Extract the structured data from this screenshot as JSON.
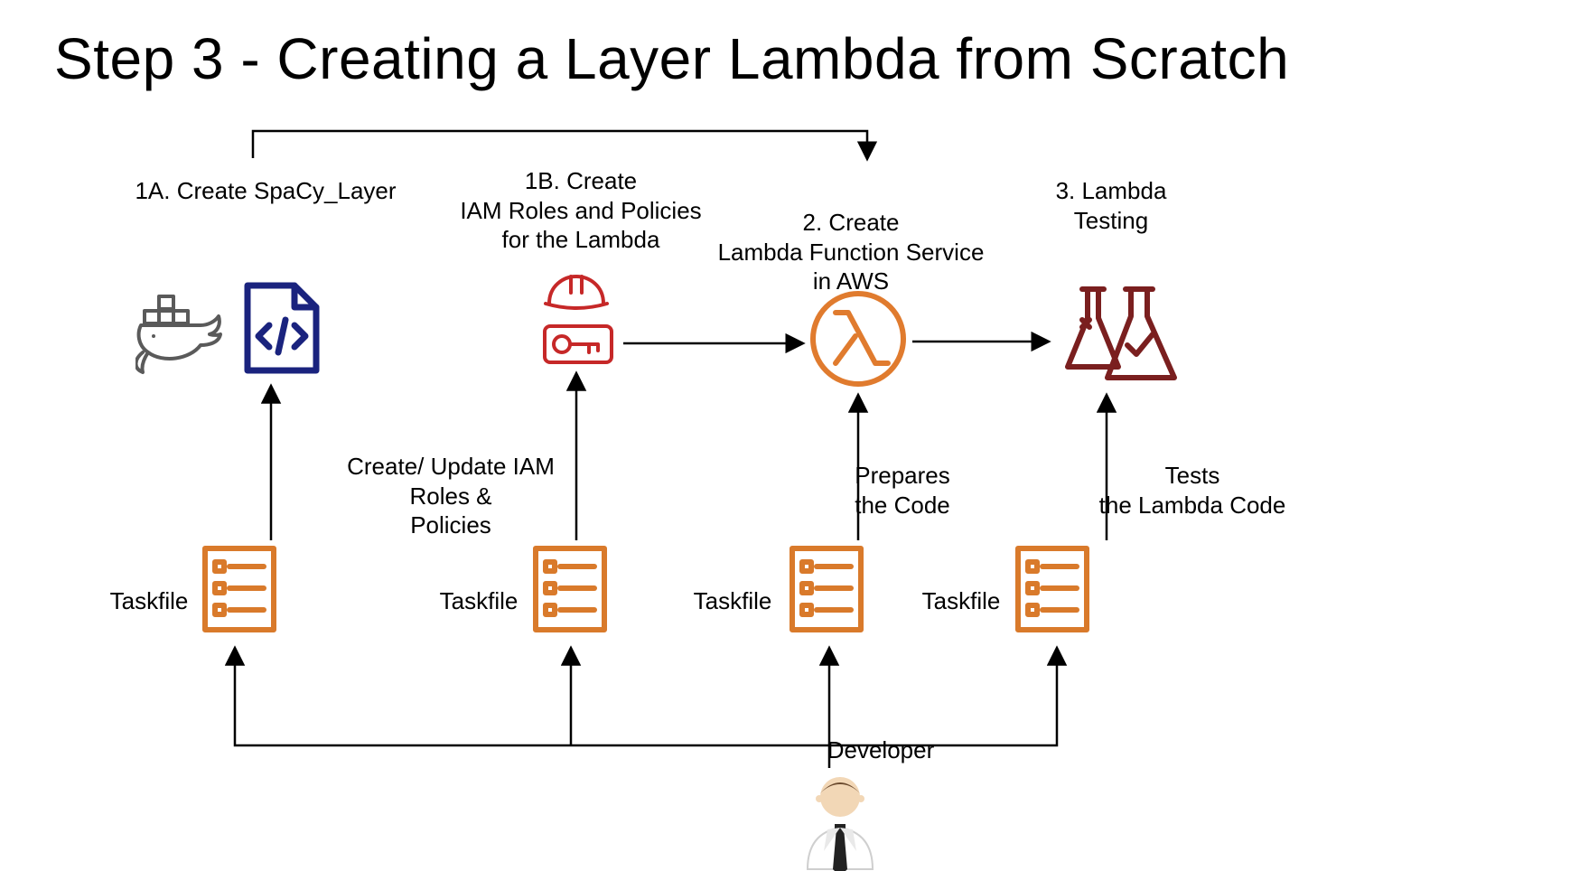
{
  "title": "Step 3 - Creating a Layer Lambda from Scratch",
  "steps": {
    "s1A": "1A. Create SpaCy_Layer",
    "s1B": "1B. Create\nIAM Roles and Policies\nfor the Lambda",
    "s2": "2. Create\nLambda Function Service\nin AWS",
    "s3": "3. Lambda\nTesting"
  },
  "notes": {
    "iam": "Create/ Update IAM\nRoles &\nPolicies",
    "prep": "Prepares\nthe Code",
    "tests": "Tests\nthe Lambda Code"
  },
  "taskfile_label": "Taskfile",
  "developer_label": "Developer",
  "colors": {
    "orange": "#d97a2b",
    "darkred": "#7a1f1f",
    "red": "#c62828",
    "navy": "#1a237e",
    "gray": "#6b6b6b",
    "black": "#000000"
  }
}
